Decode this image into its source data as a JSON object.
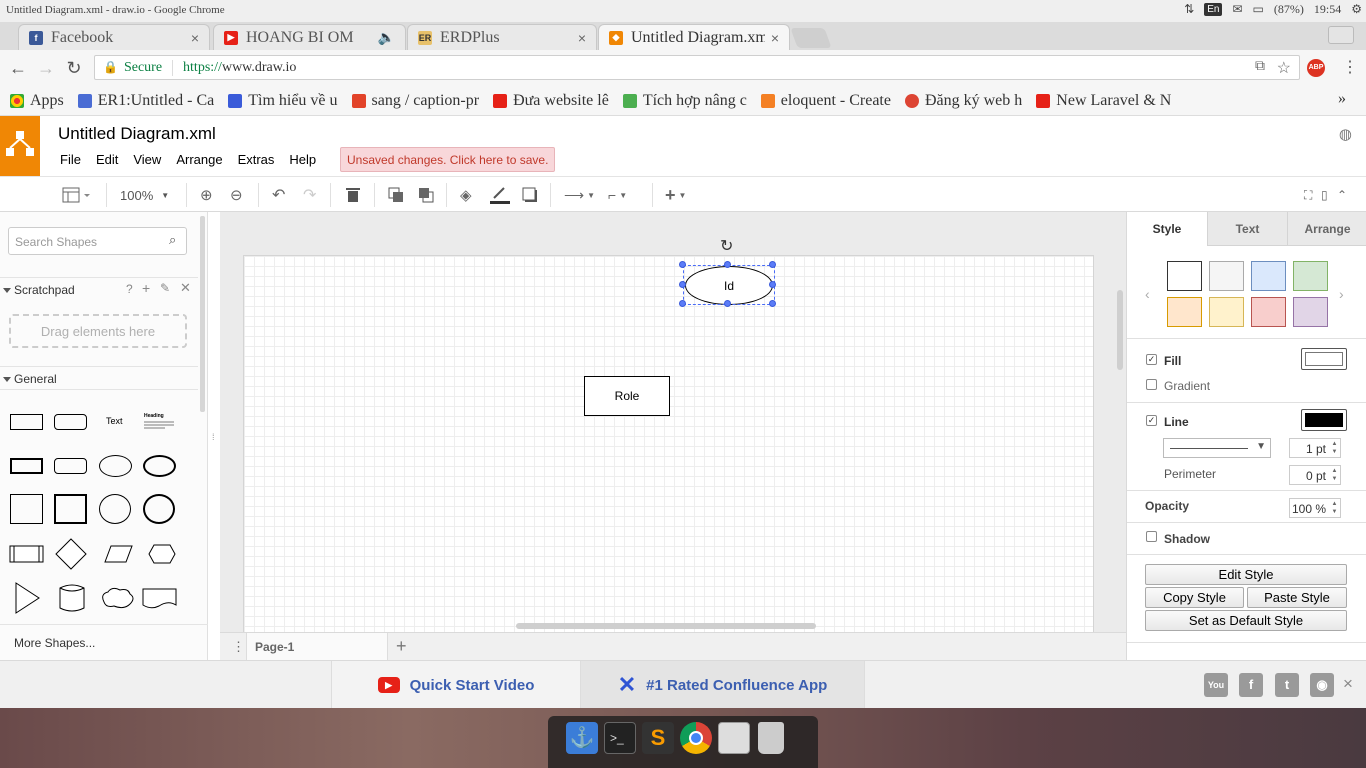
{
  "os": {
    "window_title": "Untitled Diagram.xml - draw.io - Google Chrome",
    "language": "En",
    "battery": "(87%)",
    "clock": "19:54"
  },
  "browser": {
    "tabs": [
      {
        "label": "Facebook",
        "color": "#3b5998",
        "fav": "f"
      },
      {
        "label": "HOANG BI OM",
        "color": "#e62117",
        "fav": "▶"
      },
      {
        "label": "ERDPlus",
        "color": "#e8c16a",
        "fav": "ER"
      },
      {
        "label": "Untitled Diagram.xml",
        "color": "#f08705",
        "fav": "◆"
      }
    ],
    "secure_label": "Secure",
    "url_scheme": "https://",
    "url_host": "www.draw.io",
    "extension_badge": "ABP",
    "bookmarks": [
      {
        "label": "Apps",
        "color": "#e33"
      },
      {
        "label": "ER1:Untitled - Ca",
        "color": "#4a6cd4"
      },
      {
        "label": "Tìm hiểu về u",
        "color": "#3a5bd9"
      },
      {
        "label": "sang / caption-pr",
        "color": "#e24329"
      },
      {
        "label": "Đưa website lê",
        "color": "#e62117"
      },
      {
        "label": "Tích hợp nâng c",
        "color": "#4caf50"
      },
      {
        "label": "eloquent - Create",
        "color": "#f48024"
      },
      {
        "label": "Đăng ký web h",
        "color": "#d43"
      },
      {
        "label": "New Laravel & N",
        "color": "#e62117"
      }
    ],
    "bookmarks_more": "»"
  },
  "app": {
    "title": "Untitled Diagram.xml",
    "menu": [
      "File",
      "Edit",
      "View",
      "Arrange",
      "Extras",
      "Help"
    ],
    "unsaved": "Unsaved changes. Click here to save.",
    "zoom": "100%"
  },
  "sidebar": {
    "search_placeholder": "Search Shapes",
    "scratchpad": "Scratchpad",
    "scratchpad_help": "?",
    "drag_hint": "Drag elements here",
    "general": "General",
    "text_shape": "Text",
    "heading_shape": "Heading",
    "more_shapes": "More Shapes..."
  },
  "canvas": {
    "shapes": [
      {
        "label": "Role",
        "type": "rectangle"
      },
      {
        "label": "Id",
        "type": "ellipse",
        "selected": true
      }
    ],
    "page_tab": "Page-1"
  },
  "format_panel": {
    "tabs": [
      "Style",
      "Text",
      "Arrange"
    ],
    "swatches": [
      "#ffffff",
      "#f5f5f5",
      "#dae8fc",
      "#d5e8d4",
      "#ffe6cc",
      "#fff2cc",
      "#f8cecc",
      "#e1d5e7"
    ],
    "fill": "Fill",
    "gradient": "Gradient",
    "line": "Line",
    "line_width": "1 pt",
    "perimeter": "Perimeter",
    "perimeter_value": "0 pt",
    "opacity": "Opacity",
    "opacity_value": "100 %",
    "shadow": "Shadow",
    "buttons": {
      "edit_style": "Edit Style",
      "copy_style": "Copy Style",
      "paste_style": "Paste Style",
      "set_default": "Set as Default Style"
    }
  },
  "footer": {
    "quick_start": "Quick Start Video",
    "confluence": "#1 Rated Confluence App",
    "close": "×"
  }
}
